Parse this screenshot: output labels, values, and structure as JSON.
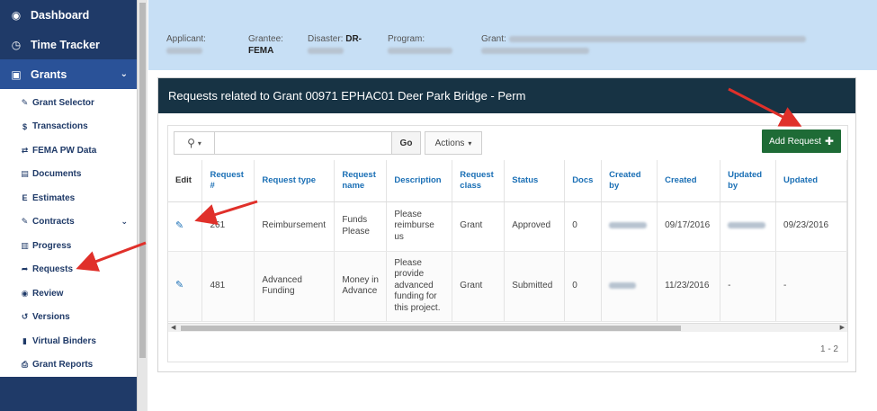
{
  "sidebar": {
    "top_items": [
      {
        "label": "Dashboard",
        "icon": "dashboard-icon"
      },
      {
        "label": "Time Tracker",
        "icon": "clock-icon"
      },
      {
        "label": "Grants",
        "icon": "money-icon"
      }
    ],
    "sub_items": [
      {
        "label": "Grant Selector",
        "icon": "edit-icon"
      },
      {
        "label": "Transactions",
        "icon": "dollar-icon"
      },
      {
        "label": "FEMA PW Data",
        "icon": "exchange-icon"
      },
      {
        "label": "Documents",
        "icon": "file-icon"
      },
      {
        "label": "Estimates",
        "icon": "ledger-icon"
      },
      {
        "label": "Contracts",
        "icon": "edit-icon"
      },
      {
        "label": "Progress",
        "icon": "bar-chart-icon"
      },
      {
        "label": "Requests",
        "icon": "share-icon"
      },
      {
        "label": "Review",
        "icon": "eye-icon"
      },
      {
        "label": "Versions",
        "icon": "history-icon"
      },
      {
        "label": "Virtual Binders",
        "icon": "book-icon"
      },
      {
        "label": "Grant Reports",
        "icon": "print-icon"
      }
    ]
  },
  "infobar": {
    "applicant_label": "Applicant:",
    "grantee_label": "Grantee:",
    "grantee_value": "FEMA",
    "disaster_label": "Disaster:",
    "disaster_value": "DR-",
    "program_label": "Program:",
    "grant_label": "Grant:"
  },
  "panel": {
    "title": "Requests related to Grant 00971 EPHAC01 Deer Park Bridge - Perm",
    "go_label": "Go",
    "actions_label": "Actions",
    "add_request_label": "Add Request",
    "pager_text": "1 - 2"
  },
  "table": {
    "headers": {
      "edit": "Edit",
      "num": "Request #",
      "type": "Request type",
      "name": "Request name",
      "desc": "Description",
      "class": "Request class",
      "status": "Status",
      "docs": "Docs",
      "created_by": "Created by",
      "created": "Created",
      "updated_by": "Updated by",
      "updated": "Updated"
    },
    "rows": [
      {
        "num": "261",
        "type": "Reimbursement",
        "name": "Funds Please",
        "desc": "Please reimburse us",
        "class": "Grant",
        "status": "Approved",
        "docs": "0",
        "created": "09/17/2016",
        "updated_by": "",
        "updated": "09/23/2016"
      },
      {
        "num": "481",
        "type": "Advanced Funding",
        "name": "Money in Advance",
        "desc": "Please provide advanced funding for this project.",
        "class": "Grant",
        "status": "Submitted",
        "docs": "0",
        "created": "11/23/2016",
        "updated_by": "-",
        "updated": "-"
      }
    ]
  },
  "colors": {
    "sidebar": "#1f3a68",
    "sidebar_active": "#2a5298",
    "infobar": "#c7dff5",
    "panel_header": "#173344",
    "add_button": "#1e6b36",
    "link": "#1a6fb5",
    "arrow": "#e0302a"
  }
}
